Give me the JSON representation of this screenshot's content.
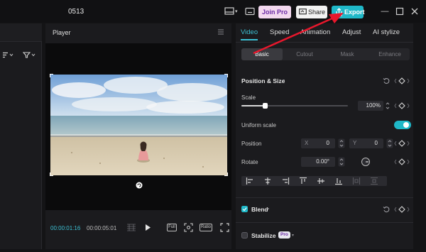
{
  "titlebar": {
    "title": "0513",
    "join_label": "Join Pro",
    "share_label": "Share",
    "export_label": "Export"
  },
  "player": {
    "title": "Player",
    "current_time": "00:00:01:16",
    "total_time": "00:00:05:01",
    "full_label": "Full",
    "ratio_label": "Ratio"
  },
  "panel": {
    "tabs": [
      "Video",
      "Speed",
      "Animation",
      "Adjust",
      "AI stylize"
    ],
    "subtabs": [
      "Basic",
      "Cutout",
      "Mask",
      "Enhance"
    ],
    "position_size": "Position & Size",
    "scale_label": "Scale",
    "scale_value": "100%",
    "scale_fraction": 0.22,
    "uniform_scale": "Uniform scale",
    "position_label": "Position",
    "x_label": "X",
    "x_value": "0",
    "y_label": "Y",
    "y_value": "0",
    "rotate_label": "Rotate",
    "rotate_value": "0.00°",
    "blend_label": "Blend",
    "stabilize_label": "Stabilize",
    "pro_badge": "Pro"
  },
  "colors": {
    "accent": "#1fb8c8",
    "arrow": "#e8172c"
  }
}
